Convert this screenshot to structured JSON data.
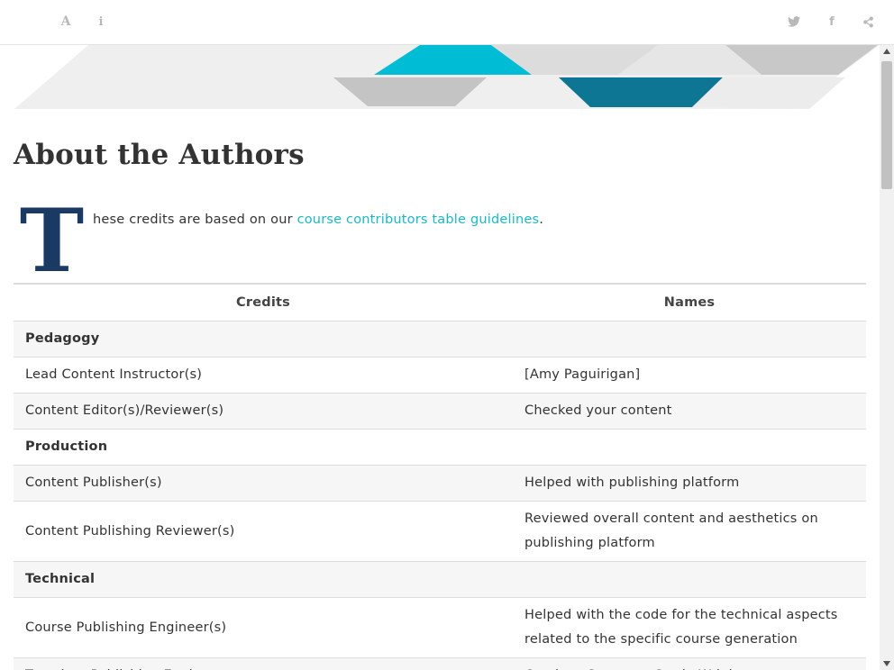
{
  "toolbar": {
    "font_icon": "A",
    "info_icon": "i",
    "facebook_icon": "f"
  },
  "page": {
    "title": "About the Authors",
    "dropcap": "T",
    "intro_text": "hese credits are based on our ",
    "intro_link": "course contributors table guidelines",
    "intro_end": "."
  },
  "table": {
    "headers": [
      "Credits",
      "Names"
    ],
    "rows": [
      {
        "credit": "Pedagogy",
        "name": ""
      },
      {
        "credit": "Lead Content Instructor(s)",
        "name": "[Amy Paguirigan]"
      },
      {
        "credit": "Content Editor(s)/Reviewer(s)",
        "name": "Checked your content"
      },
      {
        "credit": "Production",
        "name": ""
      },
      {
        "credit": "Content Publisher(s)",
        "name": "Helped with publishing platform"
      },
      {
        "credit": "Content Publishing Reviewer(s)",
        "name": "Reviewed overall content and aesthetics on publishing platform"
      },
      {
        "credit": "Technical",
        "name": ""
      },
      {
        "credit": "Course Publishing Engineer(s)",
        "name": "Helped with the code for the technical aspects related to the specific course generation"
      },
      {
        "credit": "Template Publishing Engineers",
        "name": "Candace Savonen, Carrie Wright"
      }
    ]
  },
  "icons": {
    "font": "font-size-icon",
    "info": "info-icon",
    "twitter": "twitter-icon",
    "facebook": "facebook-icon",
    "share": "share-icon"
  },
  "colors": {
    "link": "#1bb8c6",
    "dropcap": "#1b3a63",
    "banner_teal": "#00bcd4",
    "banner_dark_teal": "#0e7695",
    "banner_gray": "#c4c4c4"
  }
}
